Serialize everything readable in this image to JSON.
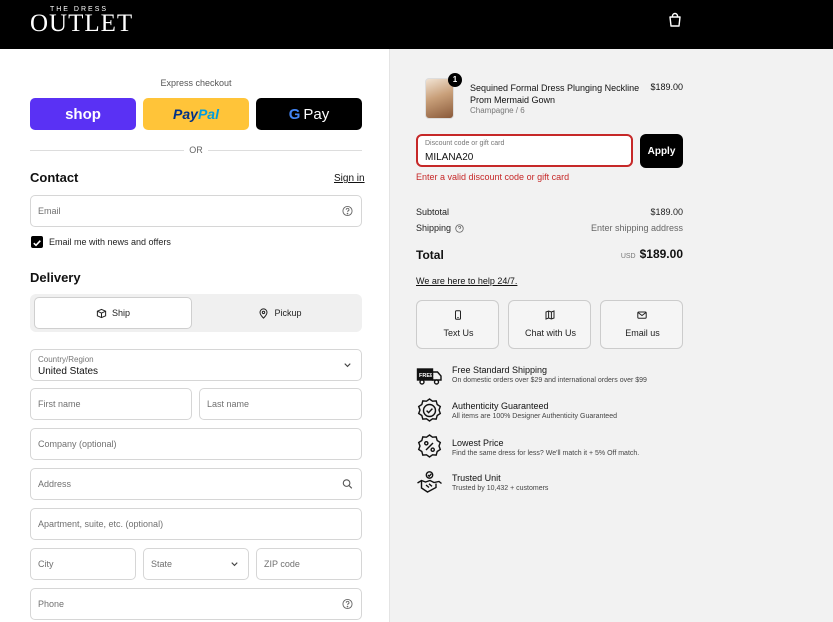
{
  "brand": {
    "small": "THE DRESS",
    "big": "OUTLET"
  },
  "express": {
    "title": "Express checkout",
    "shop_label": "shop",
    "paypal_a": "Pay",
    "paypal_b": "Pal",
    "gpay_g": "G",
    "gpay_label": "Pay",
    "or_label": "OR"
  },
  "contact": {
    "heading": "Contact",
    "sign_in": "Sign in",
    "email_placeholder": "Email",
    "news_label": "Email me with news and offers",
    "news_checked": true
  },
  "delivery": {
    "heading": "Delivery",
    "ship_label": "Ship",
    "pickup_label": "Pickup",
    "selected": "Ship",
    "country_label": "Country/Region",
    "country_value": "United States",
    "first_name": "First name",
    "last_name": "Last name",
    "company": "Company (optional)",
    "address": "Address",
    "apartment": "Apartment, suite, etc. (optional)",
    "city": "City",
    "state": "State",
    "zip": "ZIP code",
    "phone": "Phone"
  },
  "order": {
    "item": {
      "quantity": "1",
      "title": "Sequined Formal Dress Plunging Neckline Prom Mermaid Gown",
      "variant": "Champagne / 6",
      "price": "$189.00"
    },
    "discount_label": "Discount code or gift card",
    "discount_value": "MILANA20",
    "apply_label": "Apply",
    "discount_error": "Enter a valid discount code or gift card",
    "subtotal_label": "Subtotal",
    "subtotal_value": "$189.00",
    "shipping_label": "Shipping",
    "shipping_value": "Enter shipping address",
    "total_label": "Total",
    "currency": "USD",
    "total_value": "$189.00",
    "help_link": "We are here to help 24/7."
  },
  "support": [
    {
      "label": "Text Us",
      "icon": "phone-icon"
    },
    {
      "label": "Chat with Us",
      "icon": "chat-icon"
    },
    {
      "label": "Email us",
      "icon": "mail-icon"
    }
  ],
  "features": [
    {
      "title": "Free Standard Shipping",
      "subtitle": "On domestic orders over $29 and international orders over $99",
      "icon": "truck-icon"
    },
    {
      "title": "Authenticity Guaranteed",
      "subtitle": "All items are 100% Designer Authenticity Guaranteed",
      "icon": "badge-check-icon"
    },
    {
      "title": "Lowest Price",
      "subtitle": "Find the same dress for less? We'll match it + 5% Off match.",
      "icon": "percent-icon"
    },
    {
      "title": "Trusted Unit",
      "subtitle": "Trusted by 10,432 + customers",
      "icon": "handshake-icon"
    }
  ],
  "colors": {
    "error": "#c62828",
    "shop_purple": "#5a31f4",
    "paypal_yellow": "#ffc439"
  }
}
